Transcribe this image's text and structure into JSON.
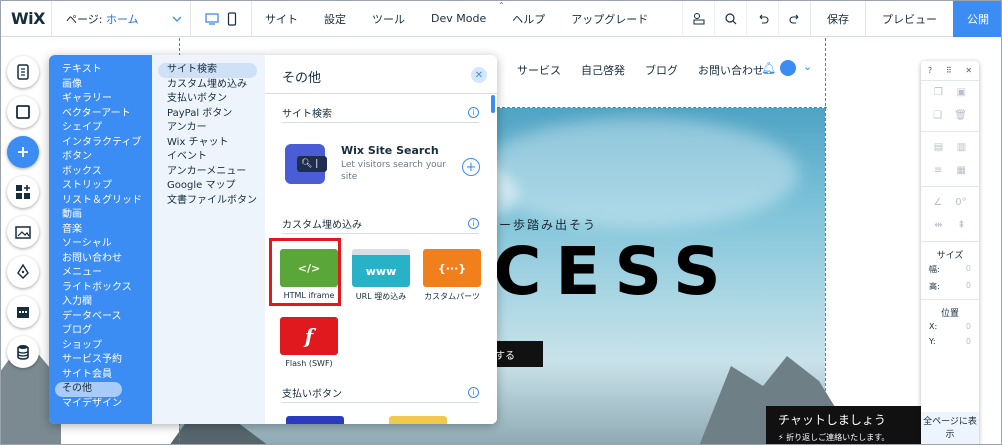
{
  "topbar": {
    "logo": "WiX",
    "page_label": "ページ:",
    "page_value": "ホーム",
    "menu": [
      "サイト",
      "設定",
      "ツール",
      "Dev Mode",
      "ヘルプ",
      "アップグレード"
    ],
    "save": "保存",
    "preview": "プレビュー",
    "publish": "公開"
  },
  "site": {
    "nav": [
      "サービス",
      "自己啓発",
      "ブログ",
      "お問い合わせ"
    ],
    "tagline": "ー歩踏み出そう",
    "headline": "CESS",
    "cta": "対する",
    "chat_title": "チャットしましょう",
    "chat_sub": "折り返しご連絡いたします。"
  },
  "add_panel": {
    "categories": [
      "テキスト",
      "画像",
      "ギャラリー",
      "ベクターアート",
      "シェイプ",
      "インタラクティブ",
      "ボタン",
      "ボックス",
      "ストリップ",
      "リスト＆グリッド",
      "動画",
      "音楽",
      "ソーシャル",
      "お問い合わせ",
      "メニュー",
      "ライトボックス",
      "入力欄",
      "データベース",
      "ブログ",
      "ショップ",
      "サービス予約",
      "サイト会員",
      "その他",
      "マイデザイン"
    ],
    "selected_category": 22,
    "subcategories": [
      "サイト検索",
      "カスタム埋め込み",
      "支払いボタン",
      "PayPal ボタン",
      "アンカー",
      "Wix チャット",
      "イベント",
      "アンカーメニュー",
      "Google マップ",
      "文書ファイルボタン"
    ],
    "selected_sub": 0,
    "title": "その他",
    "section_search": "サイト検索",
    "search_widget": {
      "title": "Wix Site Search",
      "desc": "Let visitors search your site"
    },
    "section_embed": "カスタム埋め込み",
    "tiles": [
      {
        "label": "HTML iframe",
        "icon": "</>",
        "color": "#5aa638"
      },
      {
        "label": "URL 埋め込み",
        "icon": "www",
        "color": "#27b2c8"
      },
      {
        "label": "カスタムパーツ",
        "icon": "{···}",
        "color": "#f07f1c"
      },
      {
        "label": "Flash (SWF)",
        "icon": "f",
        "color": "#e0191f"
      }
    ],
    "section_pay": "支払いボタン"
  },
  "right_panel": {
    "help": "?",
    "angle": "0°",
    "size_label": "サイズ",
    "width_label": "幅:",
    "height_label": "高:",
    "pos_label": "位置",
    "x_label": "X:",
    "y_label": "Y:",
    "zero": "0",
    "all_pages": "全ページに表示"
  }
}
